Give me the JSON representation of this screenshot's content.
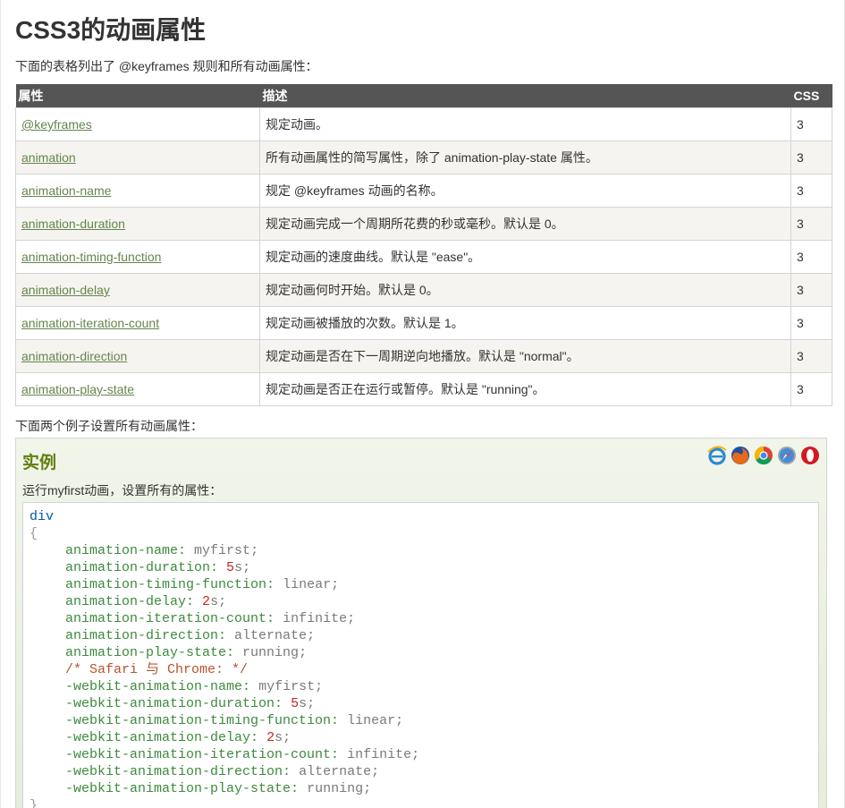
{
  "page_title": "CSS3的动画属性",
  "intro": "下面的表格列出了 @keyframes 规则和所有动画属性：",
  "table": {
    "headers": [
      "属性",
      "描述",
      "CSS"
    ],
    "rows": [
      {
        "property": "@keyframes",
        "description": "规定动画。",
        "css": "3"
      },
      {
        "property": "animation",
        "description": "所有动画属性的简写属性，除了 animation-play-state 属性。",
        "css": "3"
      },
      {
        "property": "animation-name",
        "description": "规定 @keyframes 动画的名称。",
        "css": "3"
      },
      {
        "property": "animation-duration",
        "description": "规定动画完成一个周期所花费的秒或毫秒。默认是 0。",
        "css": "3"
      },
      {
        "property": "animation-timing-function",
        "description": "规定动画的速度曲线。默认是 \"ease\"。",
        "css": "3"
      },
      {
        "property": "animation-delay",
        "description": "规定动画何时开始。默认是 0。",
        "css": "3"
      },
      {
        "property": "animation-iteration-count",
        "description": "规定动画被播放的次数。默认是 1。",
        "css": "3"
      },
      {
        "property": "animation-direction",
        "description": "规定动画是否在下一周期逆向地播放。默认是 \"normal\"。",
        "css": "3"
      },
      {
        "property": "animation-play-state",
        "description": "规定动画是否正在运行或暂停。默认是 \"running\"。",
        "css": "3"
      }
    ]
  },
  "intro2": "下面两个例子设置所有动画属性：",
  "example": {
    "heading": "实例",
    "description": "运行myfirst动画，设置所有的属性：",
    "browser_icons": [
      "ie-icon",
      "firefox-icon",
      "chrome-icon",
      "safari-icon",
      "opera-icon"
    ],
    "code": {
      "selector": "div",
      "open_brace": "{",
      "close_brace": "}",
      "declarations": [
        {
          "prop": "animation-name:",
          "value": "myfirst",
          "num": ""
        },
        {
          "prop": "animation-duration:",
          "value": "s",
          "num": "5"
        },
        {
          "prop": "animation-timing-function:",
          "value": "linear",
          "num": ""
        },
        {
          "prop": "animation-delay:",
          "value": "s",
          "num": "2"
        },
        {
          "prop": "animation-iteration-count:",
          "value": "infinite",
          "num": ""
        },
        {
          "prop": "animation-direction:",
          "value": "alternate",
          "num": ""
        },
        {
          "prop": "animation-play-state:",
          "value": "running",
          "num": ""
        }
      ],
      "comment": "/* Safari 与 Chrome: */",
      "webkit_declarations": [
        {
          "prop": "-webkit-animation-name:",
          "value": "myfirst",
          "num": ""
        },
        {
          "prop": "-webkit-animation-duration:",
          "value": "s",
          "num": "5"
        },
        {
          "prop": "-webkit-animation-timing-function:",
          "value": "linear",
          "num": ""
        },
        {
          "prop": "-webkit-animation-delay:",
          "value": "s",
          "num": "2"
        },
        {
          "prop": "-webkit-animation-iteration-count:",
          "value": "infinite",
          "num": ""
        },
        {
          "prop": "-webkit-animation-direction:",
          "value": "alternate",
          "num": ""
        },
        {
          "prop": "-webkit-animation-play-state:",
          "value": "running",
          "num": ""
        }
      ]
    }
  },
  "colors": {
    "link": "#64854c",
    "header_bg": "#555555",
    "example_heading": "#617f10"
  }
}
